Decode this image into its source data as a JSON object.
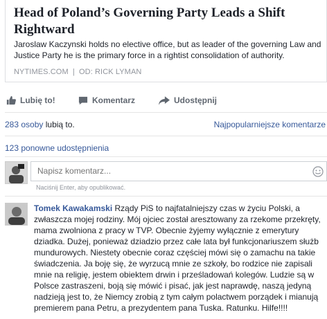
{
  "article": {
    "title": "Head of Poland’s Governing Party Leads a Shift Rightward",
    "description": "Jaroslaw Kaczynski holds no elective office, but as leader of the governing Law and Justice Party he is the primary force in a rightist consolidation of authority.",
    "source": "NYTIMES.COM",
    "separator": "|",
    "author": "OD: RICK LYMAN"
  },
  "actions": {
    "like": "Lubię to!",
    "comment": "Komentarz",
    "share": "Udostępnij"
  },
  "stats": {
    "likes_count": "283 osoby",
    "likes_text": "lubią to.",
    "sort_label": "Najpopularniejsze komentarze",
    "shares": "123 ponowne udostępnienia"
  },
  "composer": {
    "placeholder": "Napisz komentarz...",
    "hint": "Naciśnij Enter, aby opublikować."
  },
  "comment": {
    "author": "Tomek Kawakamski",
    "text": "Rządy PiS to najfatalniejszy czas w życiu Polski, a zwłaszcza mojej rodziny. Mój ojciec został aresztowany za rzekome przekręty, mama zwolniona z pracy w TVP. Obecnie żyjemy wyłącznie z emerytury dziadka. Dużej, ponieważ dziadzio przez całe lata był funkcjonariuszem służb mundurowych. Niestety obecnie coraz częściej mówi się o zamachu na takie świadczenia. Ja boję się, że wyrzucą mnie ze szkoły, bo rodzice nie zapisali mnie na religię, jestem obiektem drwin i prześladowań kolegów. Ludzie są w Polsce zastraszeni, boją się mówić i pisać, jak jest naprawdę, naszą jedyną nadzieją jest to, że Niemcy zrobią z tym całym polactwem porządek i mianują premierem pana Petru, a prezydentem pana Tuska. Ratunku. Hilfe!!!!"
  },
  "colors": {
    "link": "#365899",
    "muted": "#90949c",
    "text": "#1d2129"
  }
}
